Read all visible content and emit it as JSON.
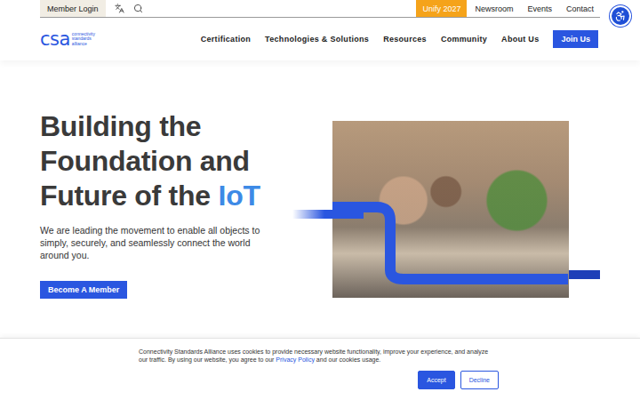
{
  "top_bar": {
    "member_login": "Member Login",
    "links": [
      {
        "label": "Unify 2027",
        "highlighted": true
      },
      {
        "label": "Newsroom",
        "highlighted": false
      },
      {
        "label": "Events",
        "highlighted": false
      },
      {
        "label": "Contact",
        "highlighted": false
      }
    ]
  },
  "nav": {
    "logo": "csa",
    "logo_tagline": [
      "connectivity",
      "standards",
      "alliance"
    ],
    "items": [
      "Certification",
      "Technologies & Solutions",
      "Resources",
      "Community",
      "About Us"
    ],
    "cta": "Join Us"
  },
  "hero": {
    "title_lines": [
      "Building the",
      "Foundation and",
      "Future of the"
    ],
    "title_accent": "IoT",
    "text": "We are leading the movement to enable all objects to simply, securely, and seamlessly connect the world around you.",
    "button": "Become A Member"
  },
  "cookie_banner": {
    "text_before": "Connectivity Standards Alliance uses cookies to provide necessary website functionality, improve your experience, and analyze our traffic. By using our website, you agree to our ",
    "link": "Privacy Policy",
    "text_after": " and our cookies usage.",
    "buttons": [
      {
        "label": "Accept",
        "primary": true
      },
      {
        "label": "Decline",
        "primary": false
      }
    ]
  }
}
